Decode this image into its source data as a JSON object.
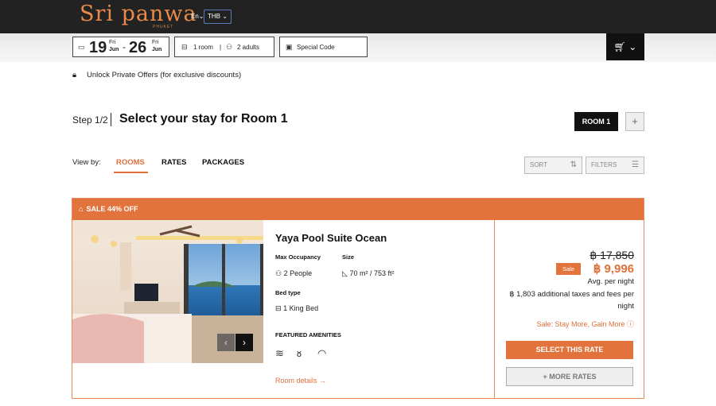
{
  "header": {
    "logo_text": "Sri panwa",
    "logo_sub": "PHUKET",
    "language": "En",
    "currency": "THB"
  },
  "booking": {
    "checkin_day": "19",
    "checkin_weekday": "Fri",
    "checkin_month": "Jun",
    "checkout_day": "26",
    "checkout_weekday": "Fri",
    "checkout_month": "Jun",
    "rooms": "1 room",
    "guests": "2 adults",
    "special_code": "Special Code"
  },
  "unlock_text": "Unlock Private Offers (for exclusive discounts)",
  "step": {
    "label": "Step 1/2",
    "title": "Select your stay for Room 1",
    "room_button": "ROOM 1",
    "add_button": "+"
  },
  "view": {
    "label": "View by:",
    "tabs": [
      "ROOMS",
      "RATES",
      "PACKAGES"
    ],
    "sort": "SORT",
    "filters": "FILTERS"
  },
  "card": {
    "sale_banner": "SALE 44% OFF",
    "room_name": "Yaya Pool Suite Ocean",
    "max_occ_label": "Max Occupancy",
    "max_occ_value": "2 People",
    "size_label": "Size",
    "size_value": "70 m² / 753 ft²",
    "bed_label": "Bed type",
    "bed_value": "1 King Bed",
    "amenities_label": "FEATURED AMENITIES",
    "details_link": "Room details →",
    "old_price": "฿ 17,850",
    "sale_tag": "Sale",
    "new_price": "฿ 9,996",
    "avg": "Avg. per night",
    "taxes": "฿ 1,803 additional taxes and fees per night",
    "promo": "Sale: Stay More, Gain More ⓘ",
    "select_button": "SELECT THIS RATE",
    "more_button": "+ MORE RATES"
  }
}
